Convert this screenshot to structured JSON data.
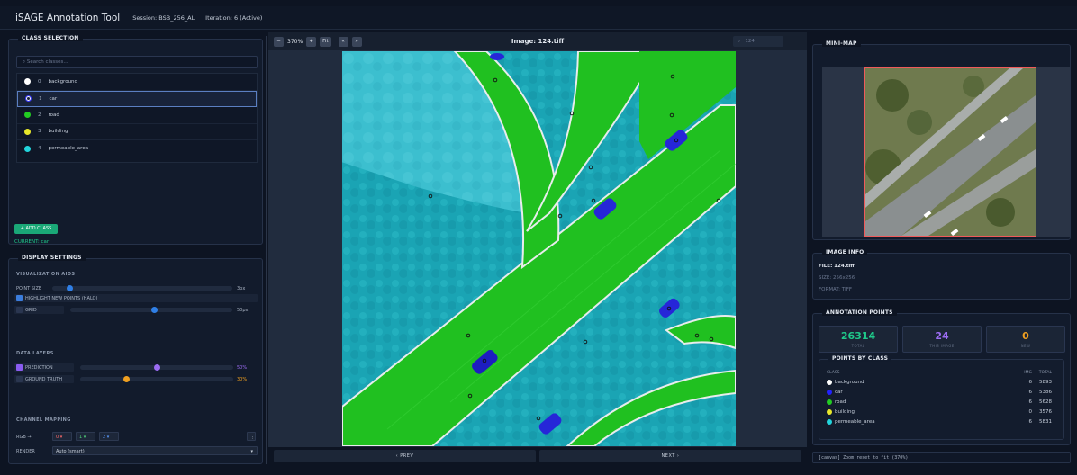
{
  "app": {
    "title": "iSAGE Annotation Tool",
    "session": "Session: BSB_256_AL",
    "iteration": "Iteration: 6 (Active)"
  },
  "class_selection": {
    "title": "CLASS SELECTION",
    "search_placeholder": "⌕ Search classes...",
    "items": [
      {
        "id": "0",
        "name": "background",
        "color": "#ffffff"
      },
      {
        "id": "1",
        "name": "car",
        "color": "#2222ff"
      },
      {
        "id": "2",
        "name": "road",
        "color": "#22cc22"
      },
      {
        "id": "3",
        "name": "building",
        "color": "#e8e82a"
      },
      {
        "id": "4",
        "name": "permeable_area",
        "color": "#22d4dc"
      }
    ],
    "add_class_label": "+ ADD CLASS",
    "current_label": "CURRENT: car"
  },
  "display_settings": {
    "title": "DISPLAY SETTINGS",
    "visualization_aids": "VISUALIZATION AIDS",
    "point_size_label": "POINT SIZE",
    "point_size_value": "3px",
    "point_size_level": 0.08,
    "highlight_label": "HIGHLIGHT NEW POINTS (HALO)",
    "grid_label": "GRID",
    "grid_value": "50px",
    "grid_level": 0.5,
    "data_layers": "DATA LAYERS",
    "prediction_label": "PREDICTION",
    "prediction_value": "50%",
    "ground_truth_label": "GROUND TRUTH",
    "ground_truth_value": "30%",
    "channel_mapping": "CHANNEL MAPPING",
    "rgb_label": "RGB →",
    "r_value": "0",
    "g_value": "1",
    "b_value": "2",
    "render_label": "RENDER",
    "render_value": "Auto (smart)"
  },
  "toolbar": {
    "zoom_out": "−",
    "zoom": "370%",
    "zoom_in": "+",
    "fit": "Fit",
    "prev_icon": "«",
    "next_icon": "»",
    "image_title": "Image: 124.tiff",
    "search_icon": "⌕",
    "search_value": "124"
  },
  "nav": {
    "prev": "‹ PREV",
    "next": "NEXT ›"
  },
  "minimap": {
    "title": "MINI-MAP"
  },
  "image_info": {
    "title": "IMAGE INFO",
    "file": "FILE: 124.tiff",
    "size": "SIZE: 256x256",
    "format": "FORMAT: TIFF"
  },
  "annotation_points": {
    "title": "ANNOTATION POINTS",
    "total_value": "26314",
    "total_label": "TOTAL",
    "this_image_value": "24",
    "this_image_label": "THIS IMAGE",
    "new_value": "0",
    "new_label": "NEW"
  },
  "points_by_class": {
    "title": "POINTS BY CLASS",
    "col_class": "CLASS",
    "col_img": "IMG",
    "col_total": "TOTAL",
    "rows": [
      {
        "name": "background",
        "img": "6",
        "total": "5893",
        "color": "#ffffff"
      },
      {
        "name": "car",
        "img": "6",
        "total": "5386",
        "color": "#2222ff"
      },
      {
        "name": "road",
        "img": "6",
        "total": "5628",
        "color": "#22cc22"
      },
      {
        "name": "building",
        "img": "0",
        "total": "3576",
        "color": "#e8e82a"
      },
      {
        "name": "permeable_area",
        "img": "6",
        "total": "5831",
        "color": "#22d4dc"
      }
    ]
  },
  "status": {
    "text": "[canvas] Zoom reset to fit (370%)"
  }
}
